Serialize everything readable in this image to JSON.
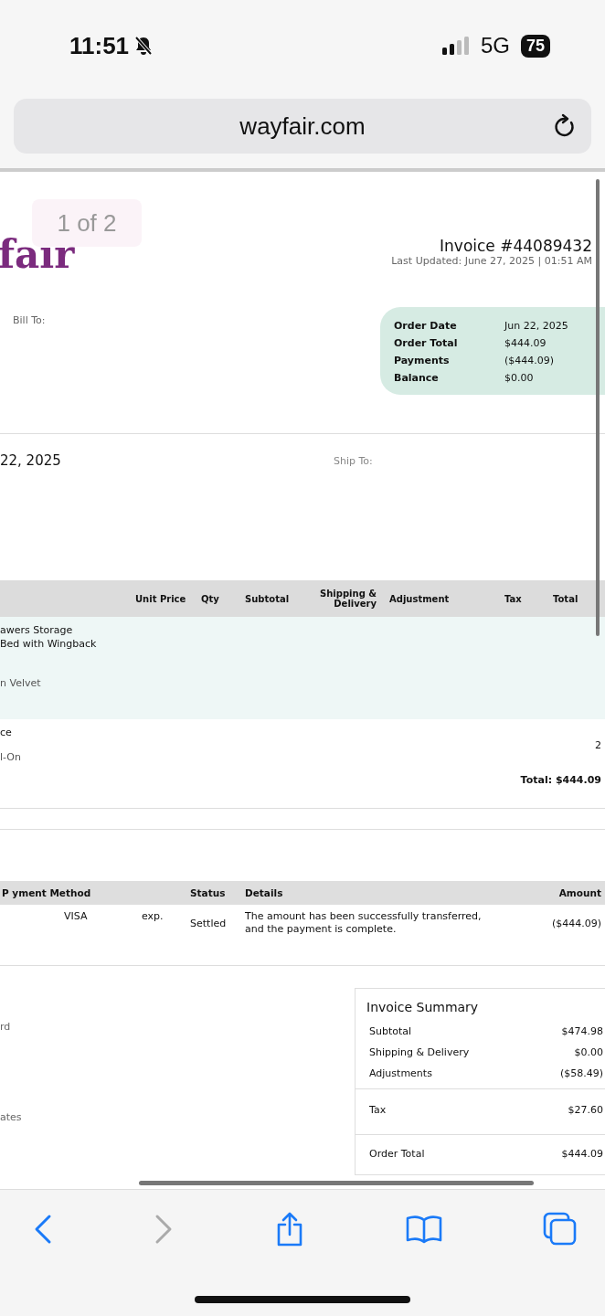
{
  "status_bar": {
    "time": "11:51",
    "network": "5G",
    "battery": "75"
  },
  "browser": {
    "url": "wayfair.com"
  },
  "page_indicator": "1 of 2",
  "invoice": {
    "logo": "fair",
    "number": "Invoice #44089432",
    "last_updated": "Last Updated: June 27, 2025 | 01:51 AM",
    "bill_to_label": "Bill To:",
    "order_info": [
      {
        "label": "Order Date",
        "value": "Jun 22, 2025"
      },
      {
        "label": "Order Total",
        "value": "$444.09"
      },
      {
        "label": "Payments",
        "value": "($444.09)"
      },
      {
        "label": "Balance",
        "value": "$0.00"
      }
    ],
    "date": "22, 2025",
    "ship_to_label": "Ship To:"
  },
  "items": {
    "columns": [
      "",
      "Unit Price",
      "Qty",
      "Subtotal",
      "Shipping & Delivery",
      "Adjustment",
      "Tax",
      "Total"
    ],
    "rows": [
      {
        "lines": [
          "awers Storage",
          "Bed with Wingback",
          "n Velvet"
        ],
        "total": "",
        "highlighted": true
      },
      {
        "lines": [
          "ce",
          "l-On"
        ],
        "total": "2",
        "highlighted": false
      }
    ],
    "grand_total": "Total: $444.09"
  },
  "payments": {
    "columns": [
      "P yment Method",
      "",
      "Status",
      "Details",
      "Amount"
    ],
    "rows": [
      {
        "method": "VISA",
        "expiry": "exp.",
        "status": "Settled",
        "details": "The amount has been successfully transferred, and the payment is complete.",
        "amount": "($444.09)"
      }
    ]
  },
  "side_fragments": [
    "rd",
    "ates"
  ],
  "summary": {
    "title": "Invoice Summary",
    "groups": [
      [
        {
          "label": "Subtotal",
          "value": "$474.98"
        },
        {
          "label": "Shipping & Delivery",
          "value": "$0.00"
        },
        {
          "label": "Adjustments",
          "value": "($58.49)"
        }
      ],
      [
        {
          "label": "Tax",
          "value": "$27.60"
        }
      ],
      [
        {
          "label": "Order Total",
          "value": "$444.09"
        }
      ]
    ]
  },
  "toolbar": [
    {
      "kind": "back",
      "disabled": false
    },
    {
      "kind": "forward",
      "disabled": true
    },
    {
      "kind": "share",
      "disabled": false
    },
    {
      "kind": "bookmarks",
      "disabled": false
    },
    {
      "kind": "tabs",
      "disabled": false
    }
  ]
}
